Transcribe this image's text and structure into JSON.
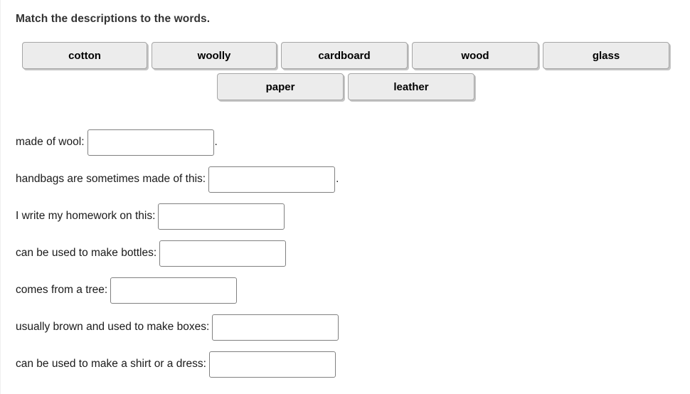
{
  "exercise": {
    "prompt": "Match the descriptions to the words.",
    "text_color": "#333333",
    "background_color": "#ffffff"
  },
  "word_bank": {
    "chip_background": "#ececec",
    "chip_border": "#a5a5a5",
    "rows": [
      [
        {
          "label": "cotton",
          "name": "word-chip-cotton"
        },
        {
          "label": "woolly",
          "name": "word-chip-woolly"
        },
        {
          "label": "cardboard",
          "name": "word-chip-cardboard"
        },
        {
          "label": "wood",
          "name": "word-chip-wood"
        },
        {
          "label": "glass",
          "name": "word-chip-glass"
        }
      ],
      [
        {
          "label": "paper",
          "name": "word-chip-paper"
        },
        {
          "label": "leather",
          "name": "word-chip-leather"
        }
      ]
    ]
  },
  "questions": [
    {
      "label": "made of wool:",
      "value": "",
      "placeholder": "",
      "trailing": "."
    },
    {
      "label": "handbags are sometimes made of this:",
      "value": "",
      "placeholder": "",
      "trailing": "."
    },
    {
      "label": "I write my homework on this:",
      "value": "",
      "placeholder": "",
      "trailing": ""
    },
    {
      "label": "can be used to make bottles:",
      "value": "",
      "placeholder": "",
      "trailing": ""
    },
    {
      "label": "comes from a tree:",
      "value": "",
      "placeholder": "",
      "trailing": ""
    },
    {
      "label": "usually brown and used to make boxes:",
      "value": "",
      "placeholder": "",
      "trailing": ""
    },
    {
      "label": "can be used to make a shirt or a dress:",
      "value": "",
      "placeholder": "",
      "trailing": ""
    }
  ]
}
